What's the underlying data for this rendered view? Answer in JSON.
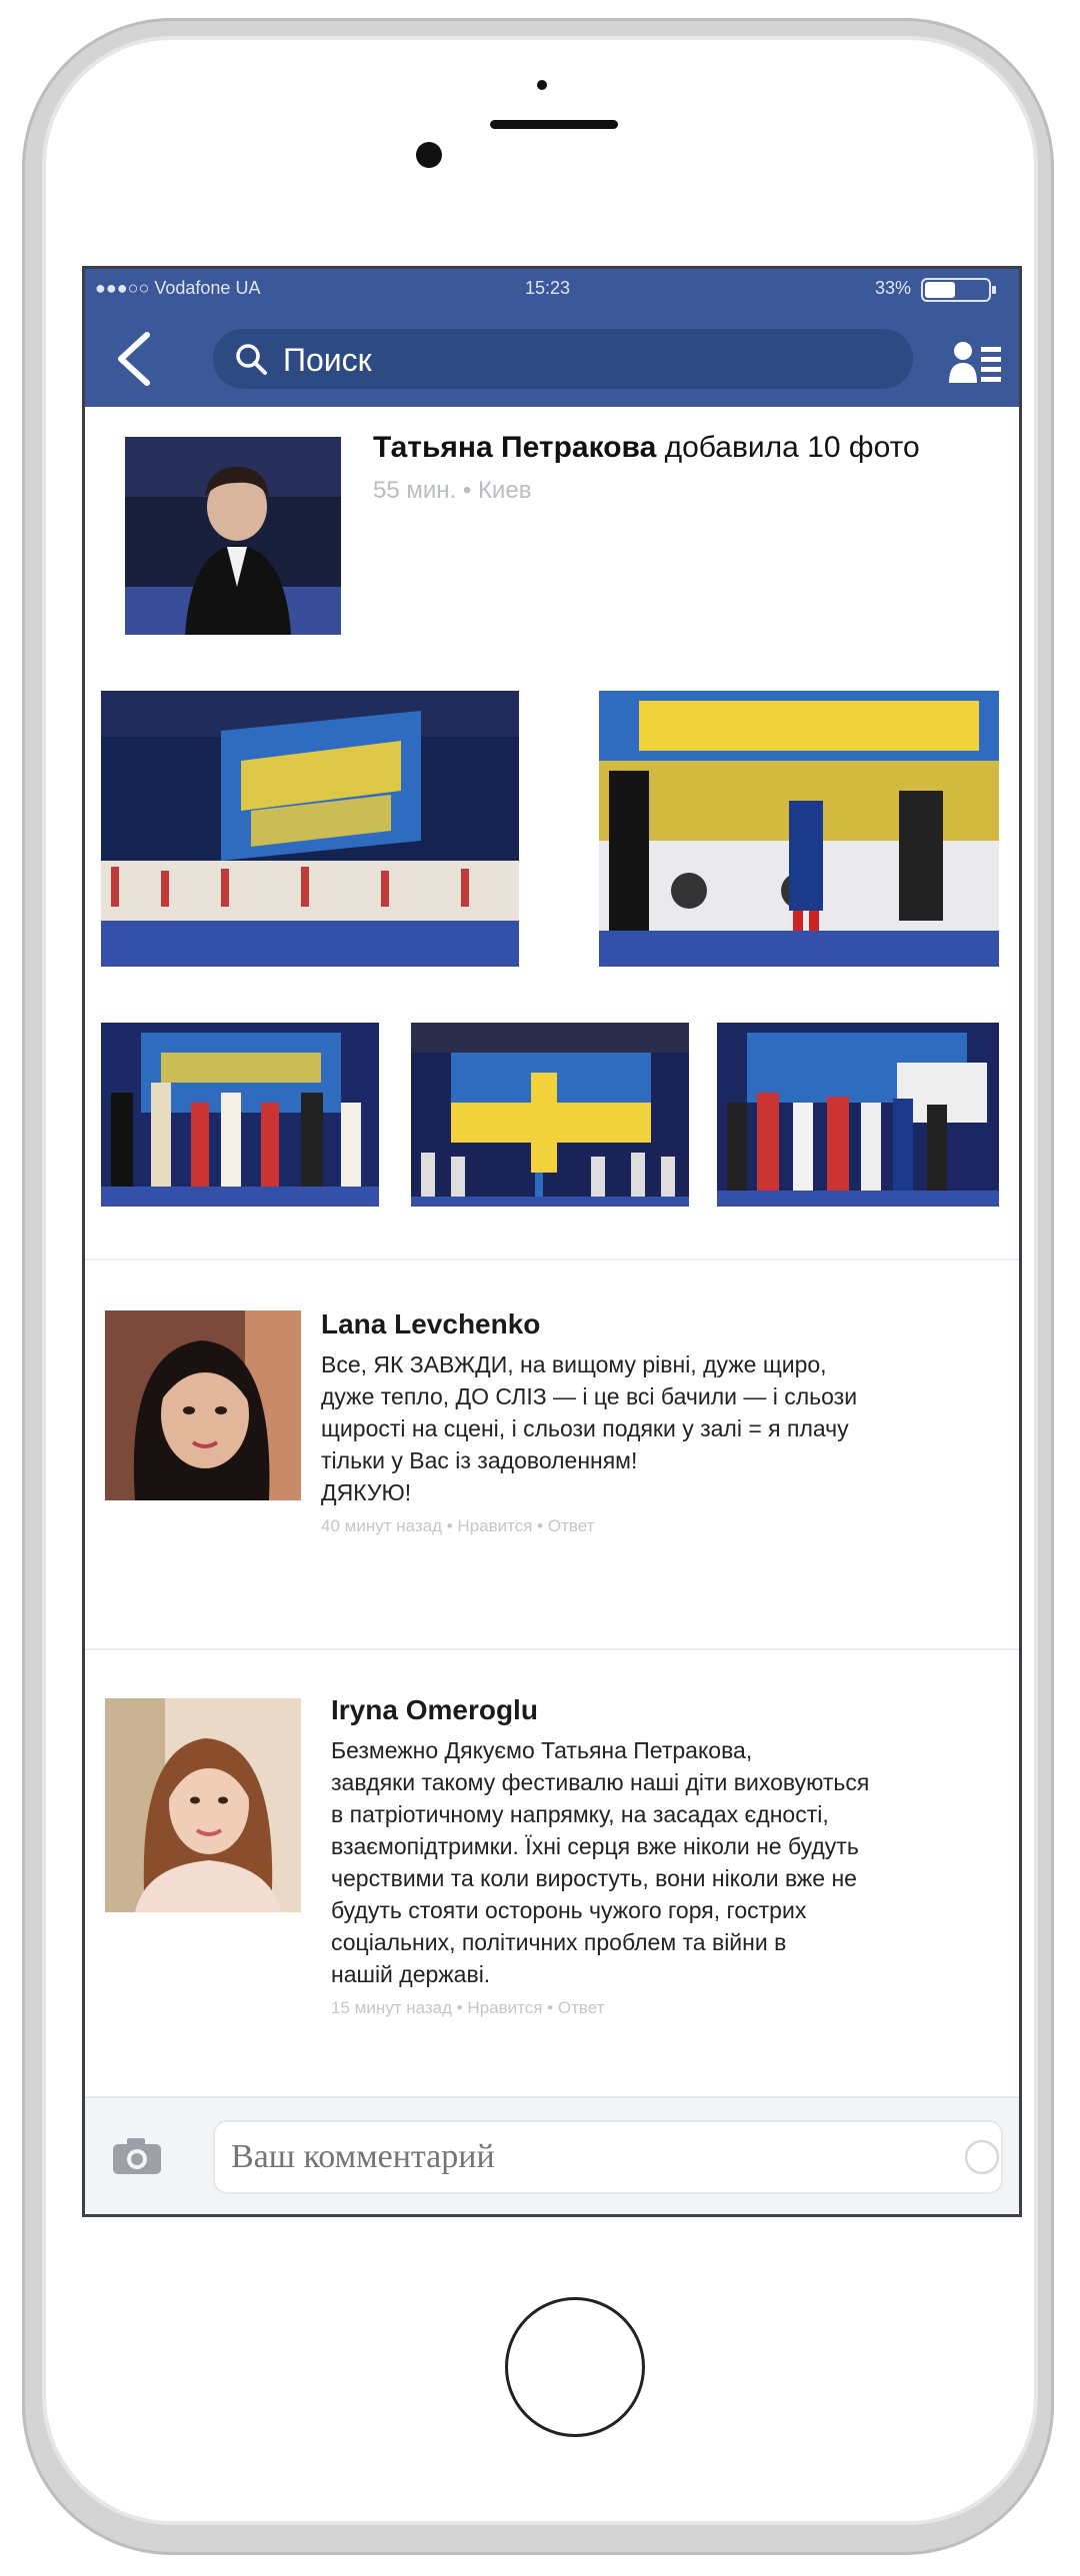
{
  "status_bar": {
    "carrier": "●●●○○ Vodafone UA",
    "time": "15:23",
    "battery_percent": "33%"
  },
  "nav": {
    "search_placeholder": "Поиск",
    "back_icon": "chevron-left-icon",
    "friends_icon": "friend-requests-icon"
  },
  "post": {
    "author": "Татьяна Петракова",
    "action": " добавила 10 фото",
    "time": "55 мин.",
    "separator": " • ",
    "location": "Киев"
  },
  "comments": [
    {
      "name": "Lana Levchenko",
      "lines": [
        "Все, ЯК ЗАВЖДИ, на вищому рівні, дуже щиро,",
        "дуже тепло, ДО СЛІЗ — і це всі бачили — і сльози",
        "щирості на сцені, і сльози подяки у залі = я плачу",
        "тільки у Вас із задоволенням!",
        "ДЯКУЮ!"
      ],
      "meta": "40 минут назад • Нравится • Ответ"
    },
    {
      "name": "Iryna Omeroglu",
      "lines": [
        "Безмежно Дякуємо Татьяна Петракова,",
        " завдяки такому фестивалю наші діти виховуються",
        " в патріотичному напрямку, на засадах єдності,",
        "взаємопідтримки. Їхні серця вже ніколи не будуть",
        "черствими та коли виростуть, вони ніколи вже не",
        "будуть стояти осторонь чужого горя, гострих",
        "соціальних, політичних проблем та війни в",
        "нашій державі."
      ],
      "meta": "15 минут назад • Нравится • Ответ"
    }
  ],
  "composer": {
    "placeholder": "Ваш комментарий",
    "camera_icon": "camera-icon",
    "emoji_icon": "emoji-icon"
  },
  "colors": {
    "facebook_blue": "#3b5998",
    "search_field": "#2e4a83",
    "banner_yellow": "#f2d23a",
    "banner_blue": "#2f6cc0"
  }
}
